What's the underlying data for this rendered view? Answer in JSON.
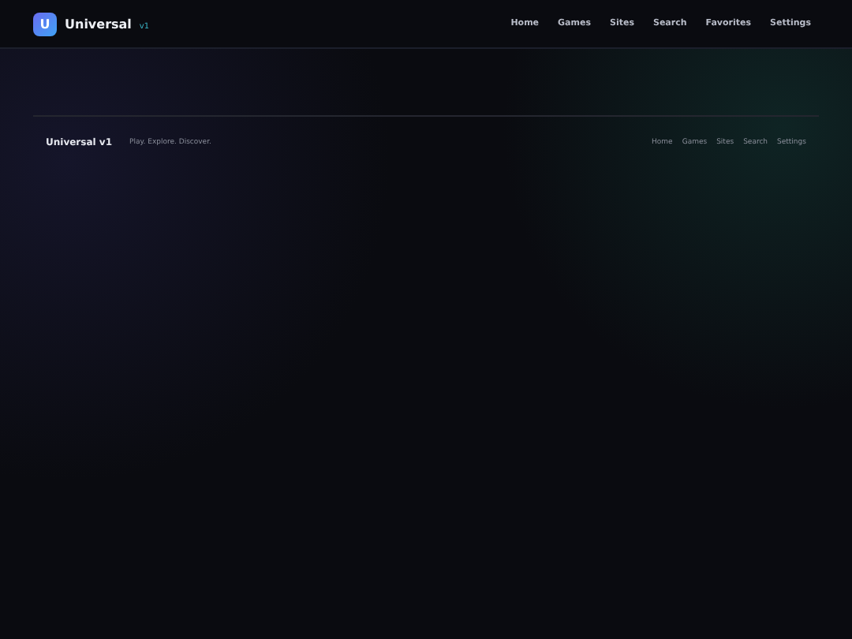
{
  "header": {
    "logo_letter": "U",
    "brand": "Universal",
    "version": "v1",
    "nav": [
      "Home",
      "Games",
      "Sites",
      "Search",
      "Favorites",
      "Settings"
    ]
  },
  "footer": {
    "brand": "Universal v1",
    "tagline": "Play. Explore. Discover.",
    "links": [
      "Home",
      "Games",
      "Sites",
      "Search",
      "Settings"
    ]
  }
}
